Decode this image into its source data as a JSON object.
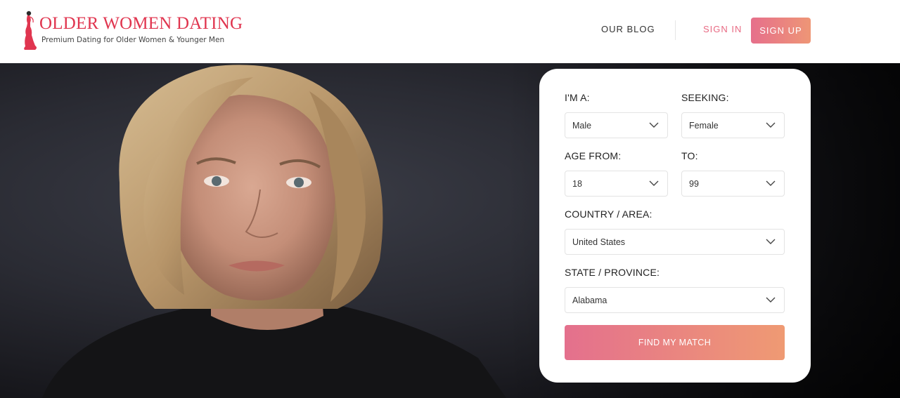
{
  "header": {
    "logo_title": "OLDER WOMEN DATING",
    "logo_tagline": "Premium Dating for Older Women & Younger Men",
    "nav": {
      "blog": "OUR BLOG",
      "sign_in": "SIGN IN",
      "sign_up": "SIGN UP"
    }
  },
  "search": {
    "im_a": {
      "label": "I'M A:",
      "value": "Male"
    },
    "seeking": {
      "label": "SEEKING:",
      "value": "Female"
    },
    "age_from": {
      "label": "AGE FROM:",
      "value": "18"
    },
    "age_to": {
      "label": "TO:",
      "value": "99"
    },
    "country": {
      "label": "COUNTRY / AREA:",
      "value": "United States"
    },
    "state": {
      "label": "STATE / PROVINCE:",
      "value": "Alabama"
    },
    "submit": "FIND MY MATCH"
  },
  "colors": {
    "brand_red": "#e0354f",
    "accent_pink": "#e66f8b",
    "accent_orange": "#ee9676"
  },
  "icons": [
    "woman-figure-logo-icon",
    "chevron-down-icon"
  ]
}
